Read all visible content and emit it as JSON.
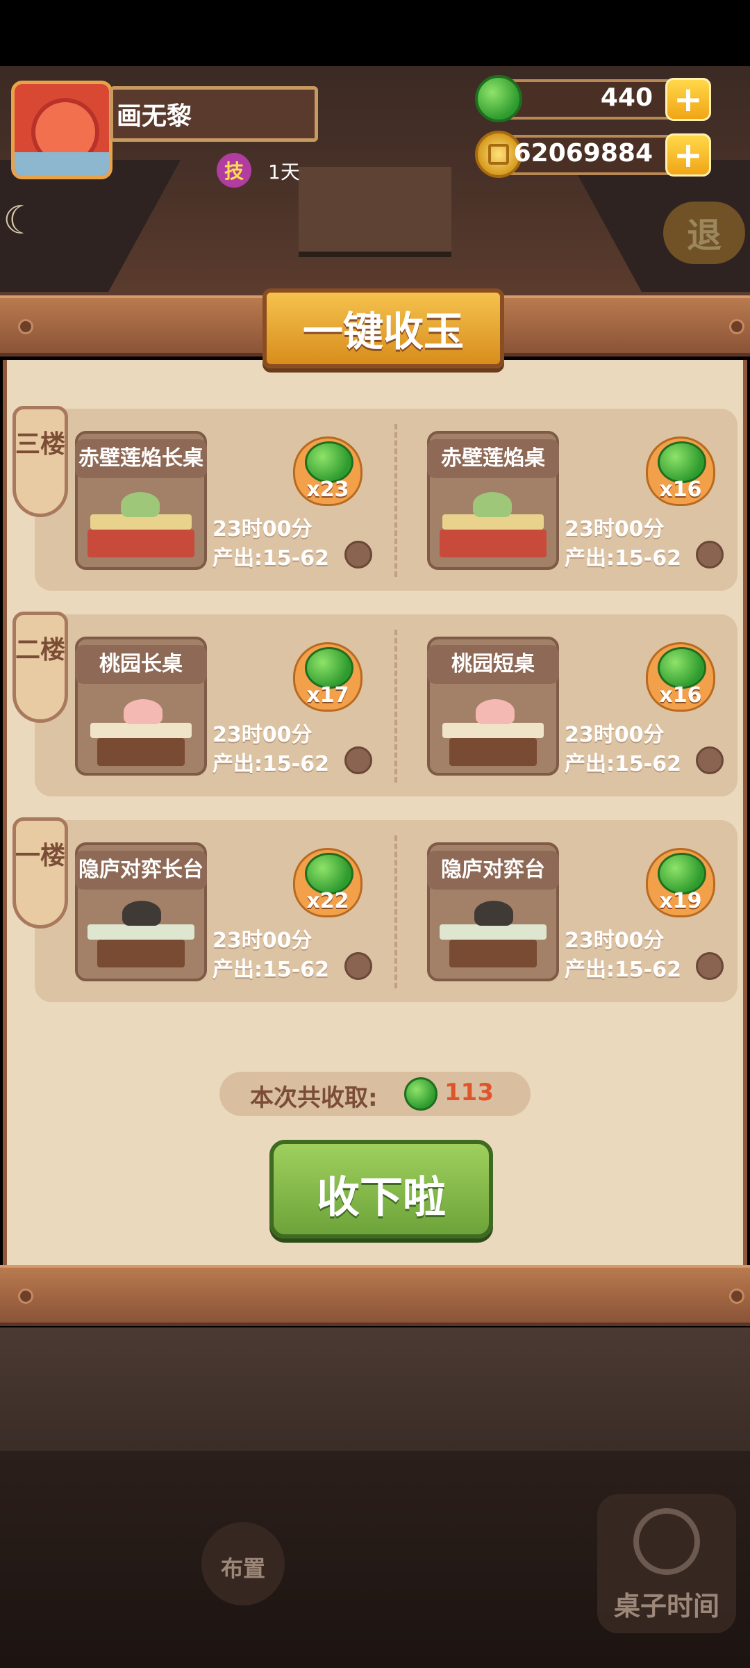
{
  "player": {
    "name": "画无黎",
    "skill_badge": "技",
    "skill_days": "1天"
  },
  "currency": {
    "jade": "440",
    "coins": "62069884",
    "plus_label": "+"
  },
  "exit_label": "退",
  "panel": {
    "title": "一键收玉",
    "floors": [
      {
        "label": "三楼",
        "tables": [
          {
            "name": "赤壁莲焰长桌",
            "count": "x23",
            "time": "23时00分",
            "output": "产出:15-62"
          },
          {
            "name": "赤壁莲焰桌",
            "count": "x16",
            "time": "23时00分",
            "output": "产出:15-62"
          }
        ]
      },
      {
        "label": "二楼",
        "tables": [
          {
            "name": "桃园长桌",
            "count": "x17",
            "time": "23时00分",
            "output": "产出:15-62"
          },
          {
            "name": "桃园短桌",
            "count": "x16",
            "time": "23时00分",
            "output": "产出:15-62"
          }
        ]
      },
      {
        "label": "一楼",
        "tables": [
          {
            "name": "隐庐对弈长台",
            "count": "x22",
            "time": "23时00分",
            "output": "产出:15-62"
          },
          {
            "name": "隐庐对弈台",
            "count": "x19",
            "time": "23时00分",
            "output": "产出:15-62"
          }
        ]
      }
    ],
    "total_label": "本次共收取:",
    "total_value": "113",
    "collect_button": "收下啦"
  },
  "bottom_bar": {
    "layout_label": "布置",
    "table_time_label": "桌子时间"
  },
  "colors": {
    "jade_green": "#2e9b2e",
    "gold": "#f0a516",
    "panel_bg": "#ebd9bd",
    "total_value_color": "#e0542b",
    "button_green": "#6da33a"
  }
}
